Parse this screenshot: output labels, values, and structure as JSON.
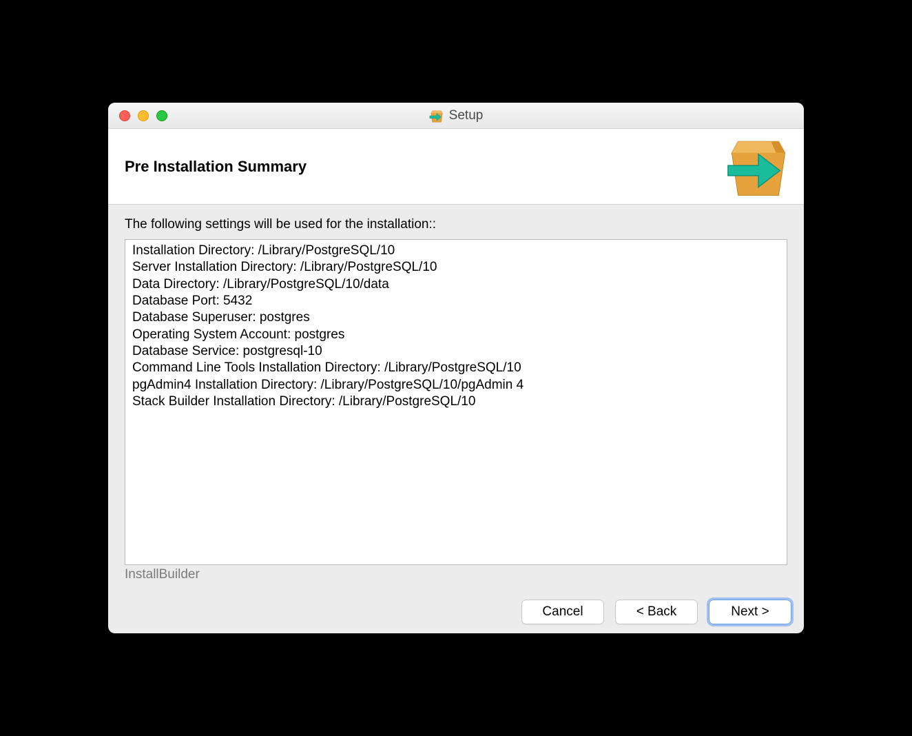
{
  "window": {
    "title": "Setup"
  },
  "header": {
    "title": "Pre Installation Summary"
  },
  "content": {
    "intro": "The following settings will be used for the installation::",
    "summary_lines": [
      "Installation Directory: /Library/PostgreSQL/10",
      "Server Installation Directory: /Library/PostgreSQL/10",
      "Data Directory: /Library/PostgreSQL/10/data",
      "Database Port: 5432",
      "Database Superuser: postgres",
      "Operating System Account: postgres",
      "Database Service: postgresql-10",
      "Command Line Tools Installation Directory: /Library/PostgreSQL/10",
      "pgAdmin4 Installation Directory: /Library/PostgreSQL/10/pgAdmin 4",
      "Stack Builder Installation Directory: /Library/PostgreSQL/10"
    ],
    "footer_label": "InstallBuilder"
  },
  "buttons": {
    "cancel": "Cancel",
    "back": "< Back",
    "next": "Next >"
  }
}
